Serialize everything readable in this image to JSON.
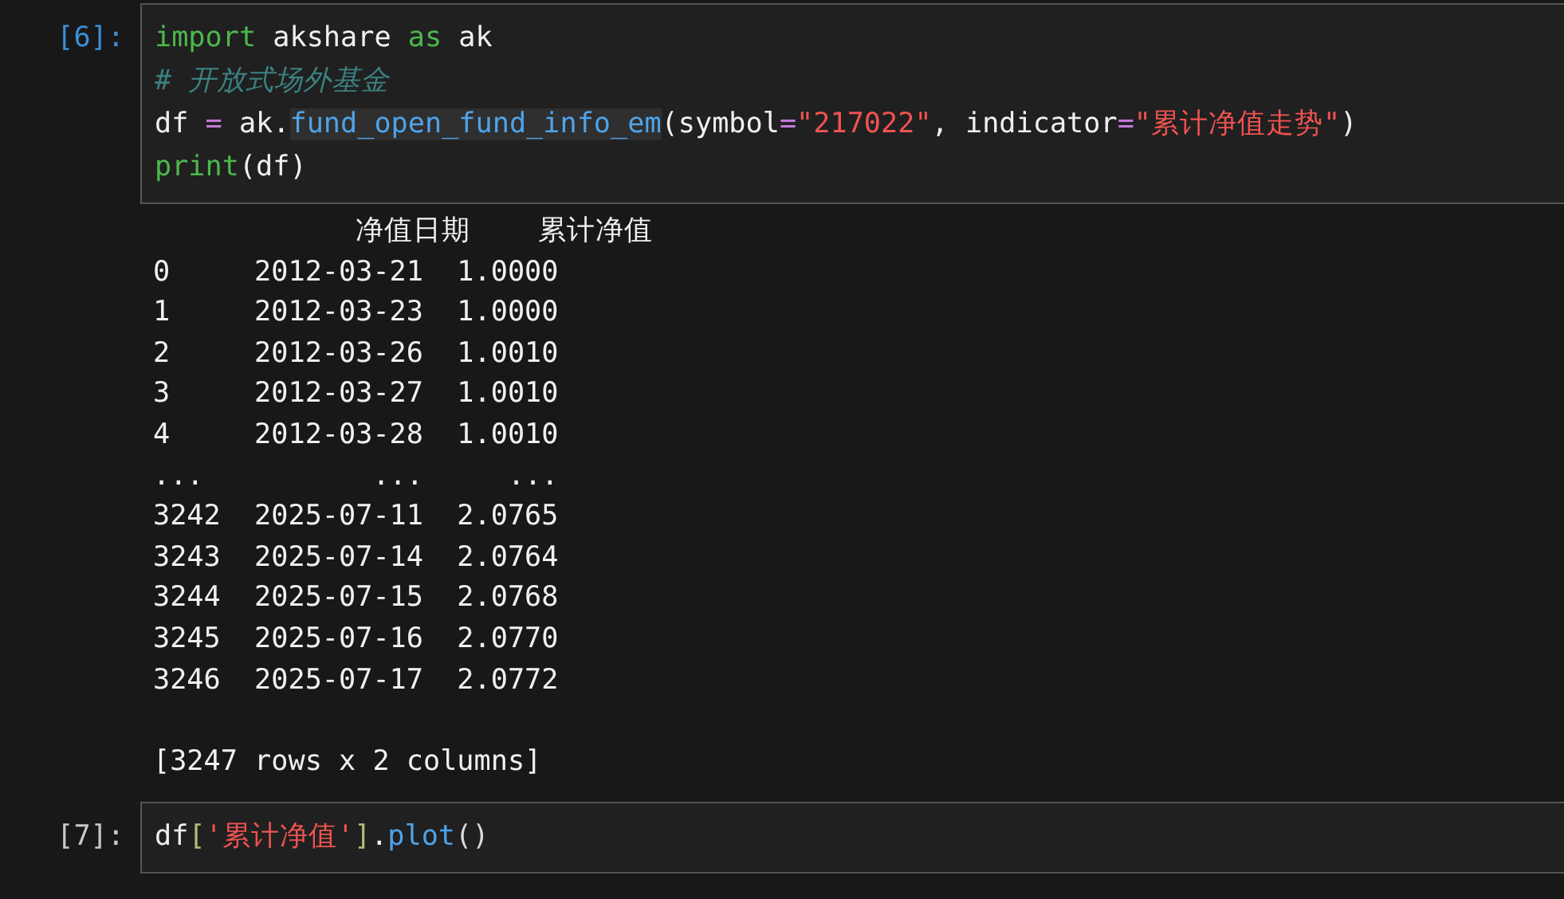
{
  "cells": [
    {
      "prompt": "[6]:",
      "selected": true,
      "code": [
        [
          {
            "kind": "keyword",
            "text": "import"
          },
          {
            "kind": "plain",
            "text": " akshare "
          },
          {
            "kind": "keyword",
            "text": "as"
          },
          {
            "kind": "plain",
            "text": " ak"
          }
        ],
        [
          {
            "kind": "comment",
            "text": "# 开放式场外基金"
          }
        ],
        [
          {
            "kind": "plain",
            "text": "df "
          },
          {
            "kind": "operator",
            "text": "="
          },
          {
            "kind": "plain",
            "text": " ak."
          },
          {
            "kind": "function-highlight",
            "text": "fund_open_fund_info_em"
          },
          {
            "kind": "plain",
            "text": "(symbol"
          },
          {
            "kind": "operator",
            "text": "="
          },
          {
            "kind": "string",
            "text": "\"217022\""
          },
          {
            "kind": "plain",
            "text": ", indicator"
          },
          {
            "kind": "operator",
            "text": "="
          },
          {
            "kind": "string",
            "text": "\"累计净值走势\""
          },
          {
            "kind": "plain",
            "text": ")"
          }
        ],
        [
          {
            "kind": "builtin",
            "text": "print"
          },
          {
            "kind": "plain",
            "text": "(df)"
          }
        ]
      ],
      "output": [
        "            净值日期    累计净值",
        "0     2012-03-21  1.0000",
        "1     2012-03-23  1.0000",
        "2     2012-03-26  1.0010",
        "3     2012-03-27  1.0010",
        "4     2012-03-28  1.0010",
        "...          ...     ...",
        "3242  2025-07-11  2.0765",
        "3243  2025-07-14  2.0764",
        "3244  2025-07-15  2.0768",
        "3245  2025-07-16  2.0770",
        "3246  2025-07-17  2.0772"
      ],
      "summary": "[3247 rows x 2 columns]"
    },
    {
      "prompt": "[7]:",
      "selected": false,
      "code": [
        [
          {
            "kind": "plain",
            "text": "df"
          },
          {
            "kind": "bracket",
            "text": "["
          },
          {
            "kind": "string",
            "text": "'累计净值'"
          },
          {
            "kind": "bracket",
            "text": "]"
          },
          {
            "kind": "plain",
            "text": "."
          },
          {
            "kind": "function",
            "text": "plot"
          },
          {
            "kind": "paren",
            "text": "()"
          }
        ]
      ]
    }
  ]
}
